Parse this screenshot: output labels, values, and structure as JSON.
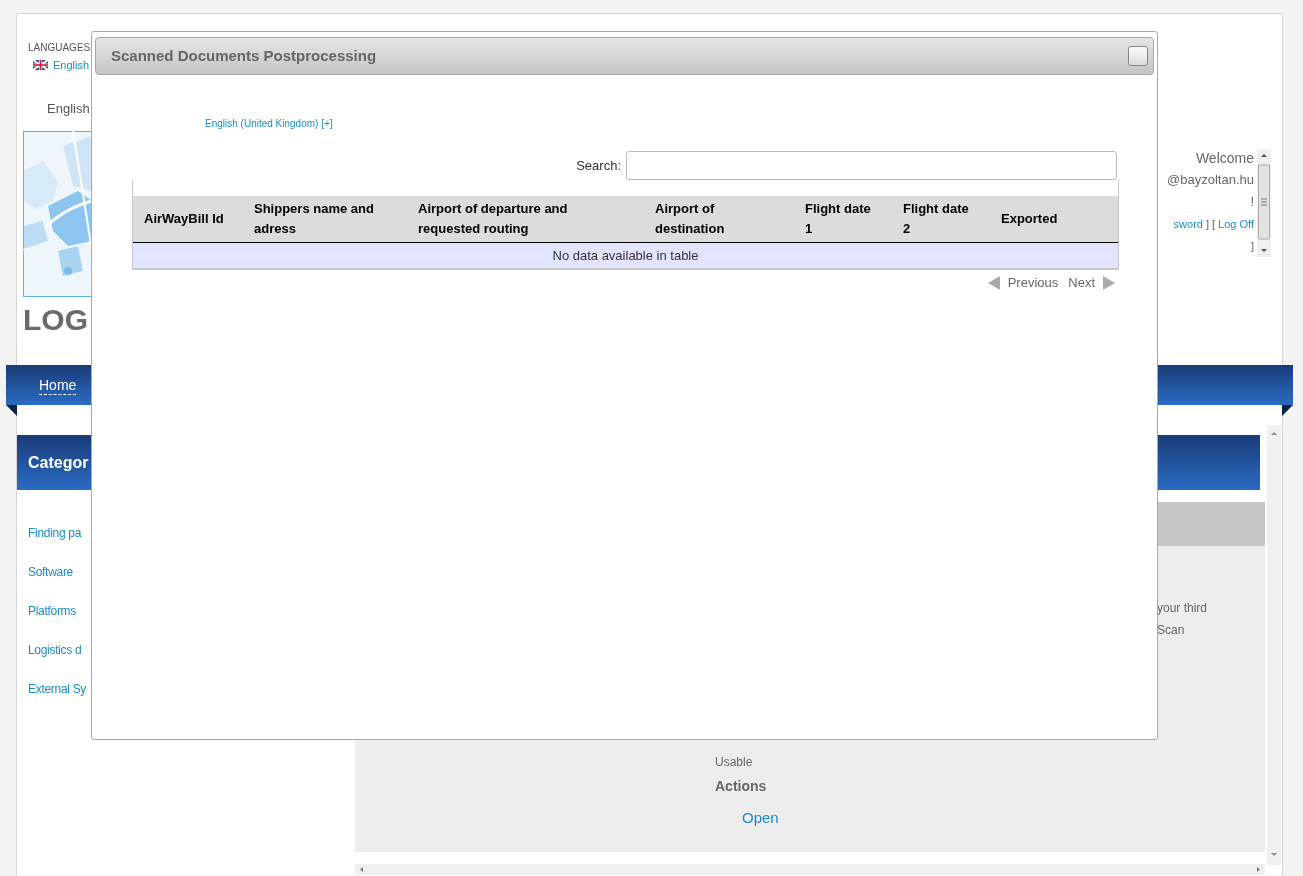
{
  "background_page": {
    "languages_label": "LANGUAGES",
    "language_link": "English",
    "language_heading": "English",
    "logo_text": "LOG",
    "user_panel": {
      "welcome": "Welcome",
      "email": "@bayzoltan.hu",
      "exclamation": "!",
      "lines": [
        [
          {
            "kind": "link",
            "text": "sword"
          },
          {
            "kind": "text",
            "text": "] ["
          },
          {
            "kind": "link",
            "text": "Log Off"
          }
        ],
        [
          {
            "kind": "text",
            "text": "]"
          }
        ]
      ]
    },
    "nav": {
      "items": [
        "Home"
      ]
    },
    "sidebar": {
      "title": "Categor",
      "items": [
        "Finding pa",
        "Software",
        "Platforms",
        "Logistics d",
        "External Sy"
      ]
    },
    "main": {
      "text_lines": [
        "your third",
        "Scan"
      ],
      "details": [
        {
          "kind": "value",
          "text": "Usable"
        },
        {
          "kind": "heading",
          "text": "Actions"
        },
        {
          "kind": "link",
          "text": "Open"
        }
      ]
    }
  },
  "dialog": {
    "title": "Scanned Documents Postprocessing",
    "language_link": "English (United Kingdom) [+]",
    "search": {
      "label": "Search:"
    },
    "table": {
      "columns": [
        "AirWayBill Id",
        "Shippers name and adress",
        "Airport of departure and requested routing",
        "Airport of destination",
        "Flight date 1",
        "Flight date 2",
        "Exported"
      ],
      "empty_message": "No data available in table"
    },
    "pagination": {
      "previous": "Previous",
      "next": "Next"
    }
  }
}
